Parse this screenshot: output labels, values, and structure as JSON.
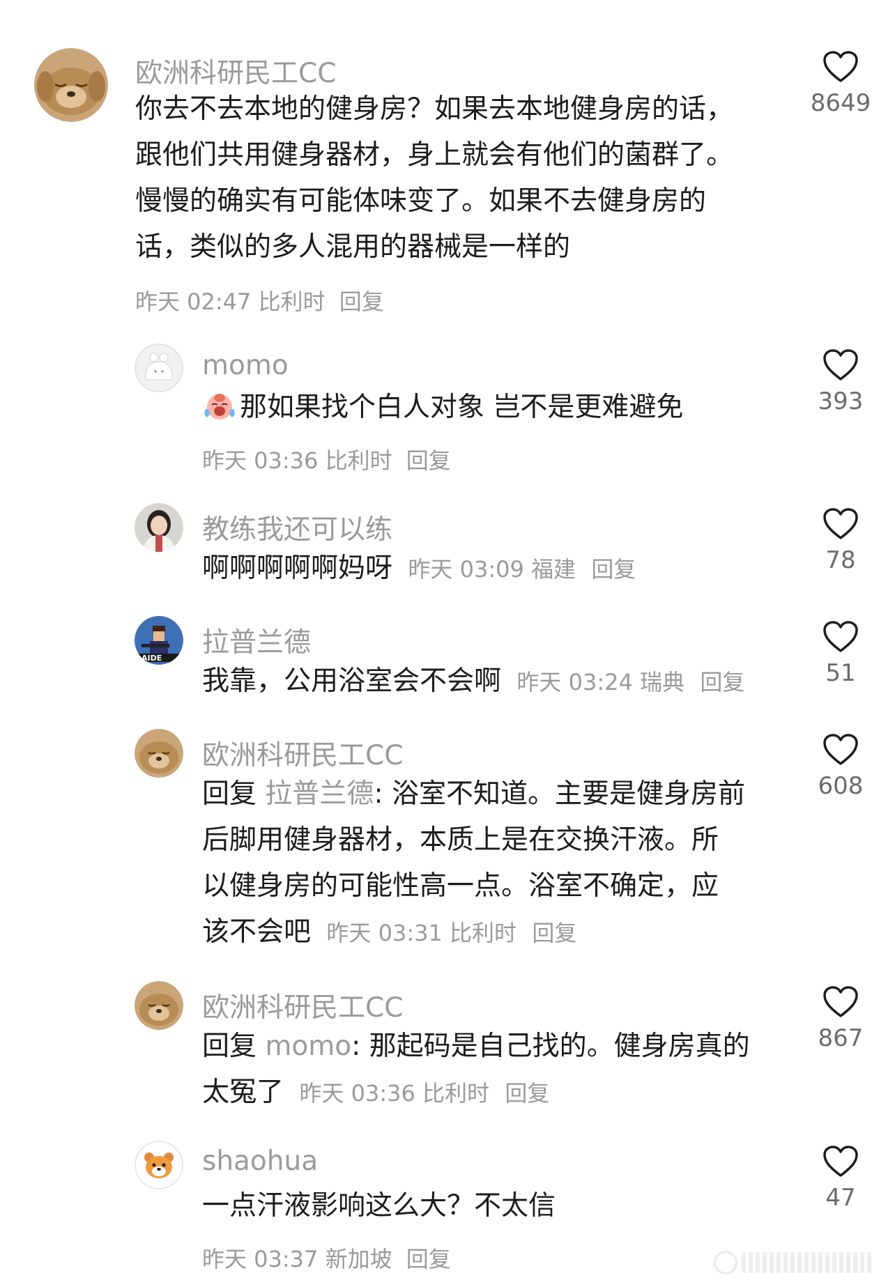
{
  "comments": [
    {
      "username": "欧洲科研民工CC",
      "avatar_icon": "puppy-avatar",
      "text_lines": [
        "你去不去本地的健身房？如果去本地健身房的话，",
        "跟他们共用健身器材，身上就会有他们的菌群了。",
        "慢慢的确实有可能体味变了。如果不去健身房的",
        "话，类似的多人混用的器械是一样的"
      ],
      "meta": "昨天 02:47 比利时",
      "reply_label": "回复",
      "likes": "8649"
    },
    {
      "username": "momo",
      "avatar_icon": "default-avatar",
      "emoji_icon": "crying-face-emoji",
      "text": "那如果找个白人对象 岂不是更难避免",
      "meta": "昨天 03:36 比利时",
      "reply_label": "回复",
      "likes": "393"
    },
    {
      "username": "教练我还可以练",
      "avatar_icon": "girl-avatar",
      "text": "啊啊啊啊啊妈呀",
      "meta": "昨天 03:09 福建",
      "reply_label": "回复",
      "likes": "78"
    },
    {
      "username": "拉普兰德",
      "avatar_icon": "pixel-character-avatar",
      "text": "我靠，公用浴室会不会啊",
      "meta": "昨天 03:24 瑞典",
      "reply_label": "回复",
      "likes": "51"
    },
    {
      "username": "欧洲科研民工CC",
      "avatar_icon": "puppy-avatar",
      "reply_prefix": "回复",
      "reply_to": "拉普兰德",
      "text_lines": [
        ": 浴室不知道。主要是健身房前",
        "后脚用健身器材，本质上是在交换汗液。所",
        "以健身房的可能性高一点。浴室不确定，应",
        "该不会吧"
      ],
      "meta": "昨天 03:31 比利时",
      "reply_label": "回复",
      "likes": "608"
    },
    {
      "username": "欧洲科研民工CC",
      "avatar_icon": "puppy-avatar",
      "reply_prefix": "回复",
      "reply_to": "momo",
      "text_lines": [
        ": 那起码是自己找的。健身房真的",
        "太冤了"
      ],
      "meta": "昨天 03:36 比利时",
      "reply_label": "回复",
      "likes": "867"
    },
    {
      "username": "shaohua",
      "avatar_icon": "hamster-avatar",
      "text": "一点汗液影响这么大？不太信",
      "meta": "昨天 03:37 新加坡",
      "reply_label": "回复",
      "likes": "47"
    }
  ],
  "like_icon": "heart-icon"
}
